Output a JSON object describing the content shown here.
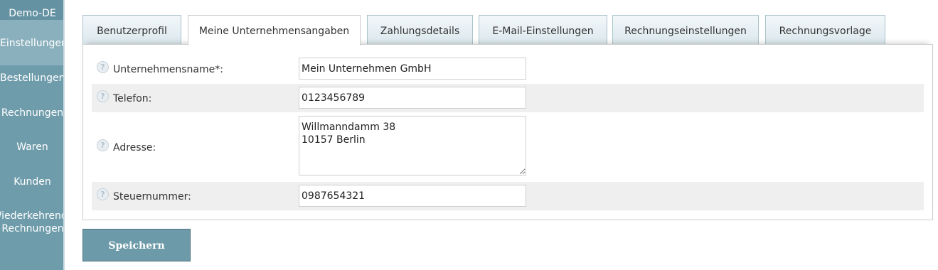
{
  "sidebar": {
    "brand": "Demo-DE",
    "items": [
      {
        "label": "Einstellungen",
        "active": true
      },
      {
        "label": "Bestellungen"
      },
      {
        "label": "Rechnungen"
      },
      {
        "label": "Waren"
      },
      {
        "label": "Kunden"
      },
      {
        "label_line1": "Wiederkehrende",
        "label_line2": "Rechnungen"
      }
    ]
  },
  "tabs": [
    {
      "label": "Benutzerprofil"
    },
    {
      "label": "Meine Unternehmensangaben",
      "active": true
    },
    {
      "label": "Zahlungsdetails"
    },
    {
      "label": "E-Mail-Einstellungen"
    },
    {
      "label": "Rechnungseinstellungen"
    },
    {
      "label": "Rechnungsvorlage"
    }
  ],
  "form": {
    "company_name": {
      "label": "Unternehmensname*:",
      "value": "Mein Unternehmen GmbH"
    },
    "phone": {
      "label": "Telefon:",
      "value": "0123456789"
    },
    "address": {
      "label": "Adresse:",
      "value": "Willmanndamm 38\n10157 Berlin"
    },
    "tax_number": {
      "label": "Steuernummer:",
      "value": "0987654321"
    },
    "help_glyph": "?"
  },
  "actions": {
    "save_label": "Speichern"
  },
  "colors": {
    "sidebar": "#6f9cab",
    "sidebar_active": "#8bb0bd",
    "button": "#6d9aa9",
    "row_alt": "#efefef"
  }
}
